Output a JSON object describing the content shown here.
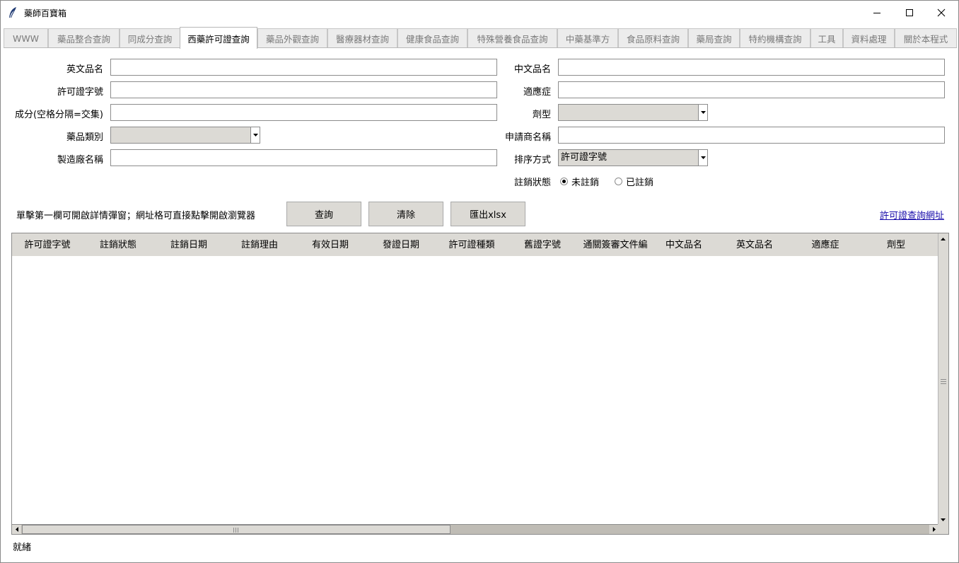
{
  "window": {
    "title": "藥師百寶箱",
    "icon": "feather-icon",
    "controls": [
      "minimize-icon",
      "maximize-icon",
      "close-icon"
    ]
  },
  "tabs": [
    {
      "label": "WWW",
      "active": false
    },
    {
      "label": "藥品整合查詢",
      "active": false
    },
    {
      "label": "同成分查詢",
      "active": false
    },
    {
      "label": "西藥許可證查詢",
      "active": true
    },
    {
      "label": "藥品外觀查詢",
      "active": false
    },
    {
      "label": "醫療器材查詢",
      "active": false
    },
    {
      "label": "健康食品查詢",
      "active": false
    },
    {
      "label": "特殊營養食品查詢",
      "active": false
    },
    {
      "label": "中藥基準方",
      "active": false
    },
    {
      "label": "食品原料查詢",
      "active": false
    },
    {
      "label": "藥局查詢",
      "active": false
    },
    {
      "label": "特約機構查詢",
      "active": false
    },
    {
      "label": "工具",
      "active": false
    },
    {
      "label": "資料處理",
      "active": false
    },
    {
      "label": "關於本程式",
      "active": false
    }
  ],
  "form": {
    "english_name": {
      "label": "英文品名",
      "value": ""
    },
    "license_no": {
      "label": "許可證字號",
      "value": ""
    },
    "ingredient": {
      "label": "成分(空格分隔=交集)",
      "value": ""
    },
    "drug_category": {
      "label": "藥品類別",
      "value": ""
    },
    "manufacturer": {
      "label": "製造廠名稱",
      "value": ""
    },
    "chinese_name": {
      "label": "中文品名",
      "value": ""
    },
    "indication": {
      "label": "適應症",
      "value": ""
    },
    "dosage_form": {
      "label": "劑型",
      "value": ""
    },
    "applicant": {
      "label": "申請商名稱",
      "value": ""
    },
    "sort_by": {
      "label": "排序方式",
      "value": "許可證字號"
    },
    "cancel_status": {
      "label": "註銷狀態",
      "options": [
        {
          "label": "未註銷",
          "checked": true
        },
        {
          "label": "已註銷",
          "checked": false
        }
      ]
    }
  },
  "actions": {
    "hint": "單擊第一欄可開啟詳情彈窗；網址格可直接點擊開啟瀏覽器",
    "query_label": "查詢",
    "clear_label": "清除",
    "export_label": "匯出xlsx",
    "link_label": "許可證查詢網址"
  },
  "table": {
    "columns": [
      "許可證字號",
      "註銷狀態",
      "註銷日期",
      "註銷理由",
      "有效日期",
      "發證日期",
      "許可證種類",
      "舊證字號",
      "通關簽審文件編",
      "中文品名",
      "英文品名",
      "適應症",
      "劑型"
    ],
    "rows": []
  },
  "status": "就緒"
}
